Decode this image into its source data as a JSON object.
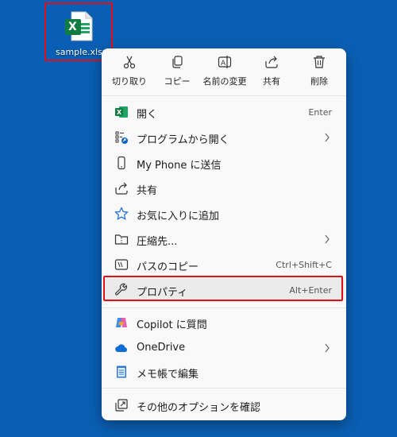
{
  "desktop": {
    "file_name": "sample.xlsx",
    "file_badge": "X"
  },
  "context_menu": {
    "quick_actions": [
      {
        "label": "切り取り",
        "icon": "scissors-icon"
      },
      {
        "label": "コピー",
        "icon": "copy-icon"
      },
      {
        "label": "名前の変更",
        "icon": "rename-icon"
      },
      {
        "label": "共有",
        "icon": "share-icon"
      },
      {
        "label": "削除",
        "icon": "trash-icon"
      }
    ],
    "items": [
      {
        "label": "開く",
        "shortcut": "Enter",
        "icon": "excel-icon"
      },
      {
        "label": "プログラムから開く",
        "shortcut": "",
        "icon": "open-with-icon",
        "submenu": true
      },
      {
        "label": "My Phone に送信",
        "shortcut": "",
        "icon": "phone-icon"
      },
      {
        "label": "共有",
        "shortcut": "",
        "icon": "share-icon"
      },
      {
        "label": "お気に入りに追加",
        "shortcut": "",
        "icon": "star-icon"
      },
      {
        "label": "圧縮先...",
        "shortcut": "",
        "icon": "zip-folder-icon",
        "submenu": true
      },
      {
        "label": "パスのコピー",
        "shortcut": "Ctrl+Shift+C",
        "icon": "copy-path-icon"
      },
      {
        "label": "プロパティ",
        "shortcut": "Alt+Enter",
        "icon": "wrench-icon",
        "highlighted": true
      },
      {
        "label": "Copilot に質問",
        "shortcut": "",
        "icon": "copilot-icon"
      },
      {
        "label": "OneDrive",
        "shortcut": "",
        "icon": "onedrive-icon",
        "submenu": true
      },
      {
        "label": "メモ帳で編集",
        "shortcut": "",
        "icon": "notepad-icon"
      },
      {
        "label": "その他のオプションを確認",
        "shortcut": "",
        "icon": "more-options-icon"
      }
    ]
  },
  "colors": {
    "desktop_bg": "#0a5fb4",
    "highlight_border": "#e0101a",
    "excel_green": "#107c41"
  }
}
